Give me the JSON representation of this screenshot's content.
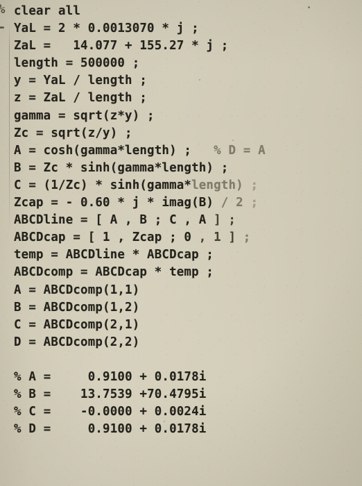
{
  "document": {
    "kind": "photograph-of-printed-matlab-code",
    "language": "MATLAB",
    "paper_color": "#d6d1bd",
    "ink_color": "#27261f"
  },
  "edge_marks": {
    "top_glyph": "%",
    "second_glyph": "-"
  },
  "code": {
    "lines": [
      {
        "id": "l01",
        "text": "clear all",
        "indent": 1
      },
      {
        "id": "l02",
        "text": "YaL = 2 * 0.0013070 * j ;",
        "indent": 1
      },
      {
        "id": "l03",
        "text": "ZaL =   14.077 + 155.27 * j ;",
        "indent": 1
      },
      {
        "id": "l04",
        "text": "length = 500000 ;",
        "indent": 1
      },
      {
        "id": "l05",
        "text": "y = YaL / length ;",
        "indent": 1
      },
      {
        "id": "l06",
        "text": "z = ZaL / length ;",
        "indent": 1
      },
      {
        "id": "l07",
        "text": "gamma = sqrt(z*y) ;",
        "indent": 1
      },
      {
        "id": "l08",
        "text": "Zc = sqrt(z/y) ;",
        "indent": 1
      },
      {
        "id": "l09",
        "text": "A = cosh(gamma*length) ;",
        "indent": 1,
        "trailing_comment": "  % D = A"
      },
      {
        "id": "l10",
        "text": "B = Zc * sinh(gamma*length) ;",
        "indent": 1
      },
      {
        "id": "l11",
        "text": "C = (1/Zc) * sinh(gamma*length) ;",
        "indent": 1
      },
      {
        "id": "l12",
        "text": "Zcap = - 0.60 * j * imag(B) / 2 ;",
        "indent": 1
      },
      {
        "id": "l13",
        "text": "ABCDline = [ A , B ; C , A ] ;",
        "indent": 1
      },
      {
        "id": "l14",
        "text": "ABCDcap = [ 1 , Zcap ; 0 , 1 ] ;",
        "indent": 1
      },
      {
        "id": "l15",
        "text": "temp = ABCDline * ABCDcap ;",
        "indent": 1
      },
      {
        "id": "l16",
        "text": "ABCDcomp = ABCDcap * temp ;",
        "indent": 1
      },
      {
        "id": "l17",
        "text": "A = ABCDcomp(1,1)",
        "indent": 1
      },
      {
        "id": "l18",
        "text": "B = ABCDcomp(1,2)",
        "indent": 1
      },
      {
        "id": "l19",
        "text": "C = ABCDcomp(2,1)",
        "indent": 1
      },
      {
        "id": "l20",
        "text": "D = ABCDcomp(2,2)",
        "indent": 1
      },
      {
        "id": "l21",
        "text": "",
        "indent": 0
      }
    ]
  },
  "results_comment_block": {
    "rows": [
      {
        "id": "r1",
        "marker": "%",
        "name": "A",
        "equals": "=",
        "value": "  0.9100 + 0.0178i",
        "real": "0.9100",
        "imag": "0.0178",
        "sign": "+"
      },
      {
        "id": "r2",
        "marker": "%",
        "name": "B",
        "equals": "=",
        "value": " 13.7539 +70.4795i",
        "real": "13.7539",
        "imag": "70.4795",
        "sign": "+"
      },
      {
        "id": "r3",
        "marker": "%",
        "name": "C",
        "equals": "=",
        "value": " -0.0000 + 0.0024i",
        "real": "-0.0000",
        "imag": "0.0024",
        "sign": "+"
      },
      {
        "id": "r4",
        "marker": "%",
        "name": "D",
        "equals": "=",
        "value": "  0.9100 + 0.0178i",
        "real": "0.9100",
        "imag": "0.0178",
        "sign": "+"
      }
    ]
  },
  "fragments": {
    "l09_main": "A = cosh(gamma*length) ;",
    "l09_comment": "   % D = A",
    "l11_a": "C = (1/Zc) * sinh(gamma*",
    "l11_b": "length)",
    "l11_c": " ;",
    "l12_a": "Zcap = - 0.60 * j * imag(B) ",
    "l12_b": "/ 2",
    "l12_c": " ;",
    "l13_a": "ABCDline = [ A , B ; C , A ",
    "l13_b": "] ;",
    "l14_a": "ABCDcap = [ 1 , Zcap ; 0 ",
    "l14_b": ", 1 ] ",
    "l14_c": ";"
  }
}
